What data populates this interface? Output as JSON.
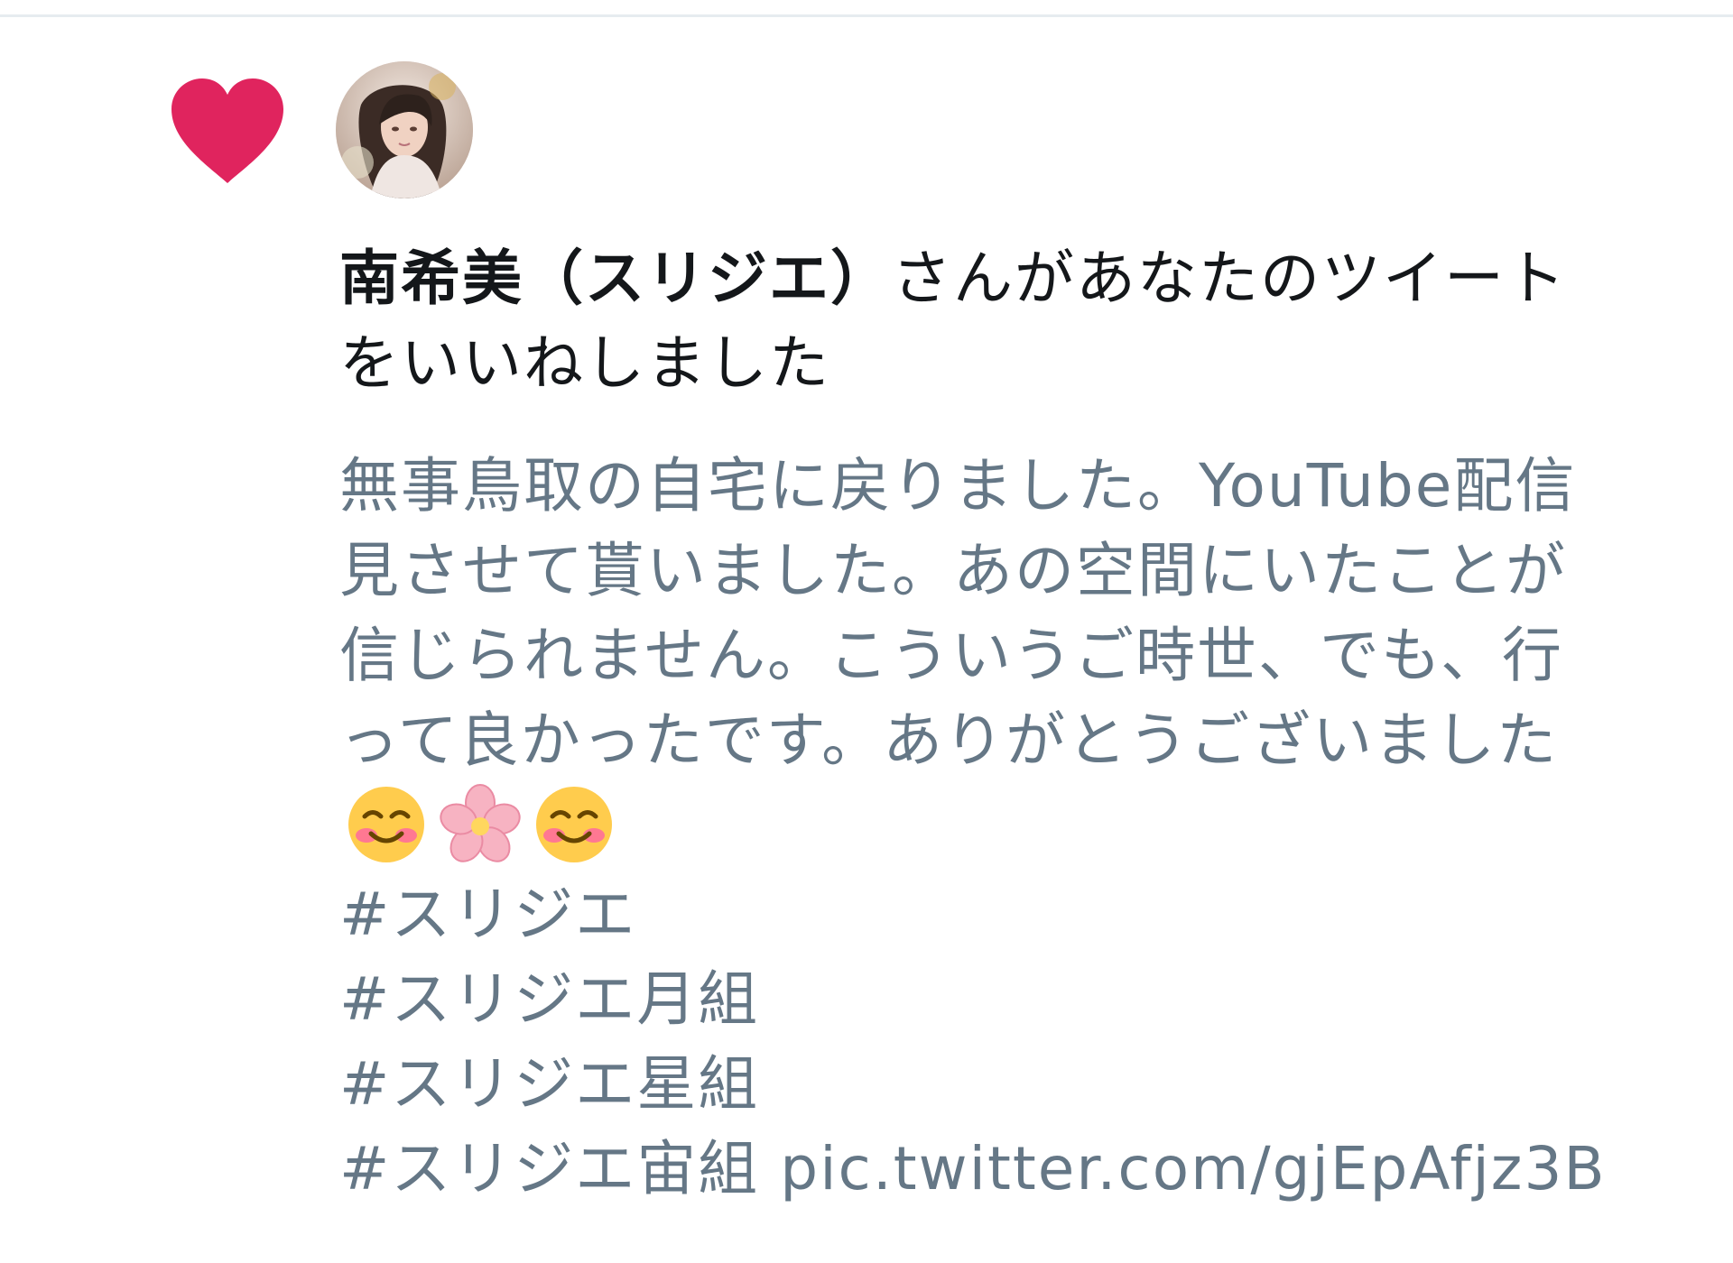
{
  "notification": {
    "type_icon": "heart-icon",
    "avatar_icon": "user-avatar",
    "user_name": "南希美（スリジエ）",
    "action_text": "さんがあなたのツイートをいいねしました",
    "tweet": {
      "text_before_emoji": "無事鳥取の自宅に戻りました。YouTube配信見させて貰いました。あの空間にいたことが信じられません。こういうご時世、でも、行って良かったです。ありがとうございました",
      "emoji": [
        "smiling-face-icon",
        "cherry-blossom-icon",
        "smiling-face-icon"
      ],
      "hashtags": [
        "#スリジエ",
        "#スリジエ月組",
        "#スリジエ星組",
        "#スリジエ宙組"
      ],
      "link": "pic.twitter.com/gjEpAfjz3B"
    }
  },
  "colors": {
    "heart": "#e0245e",
    "primary_text": "#14171a",
    "secondary_text": "#657786",
    "divider": "#e6ecf0"
  }
}
